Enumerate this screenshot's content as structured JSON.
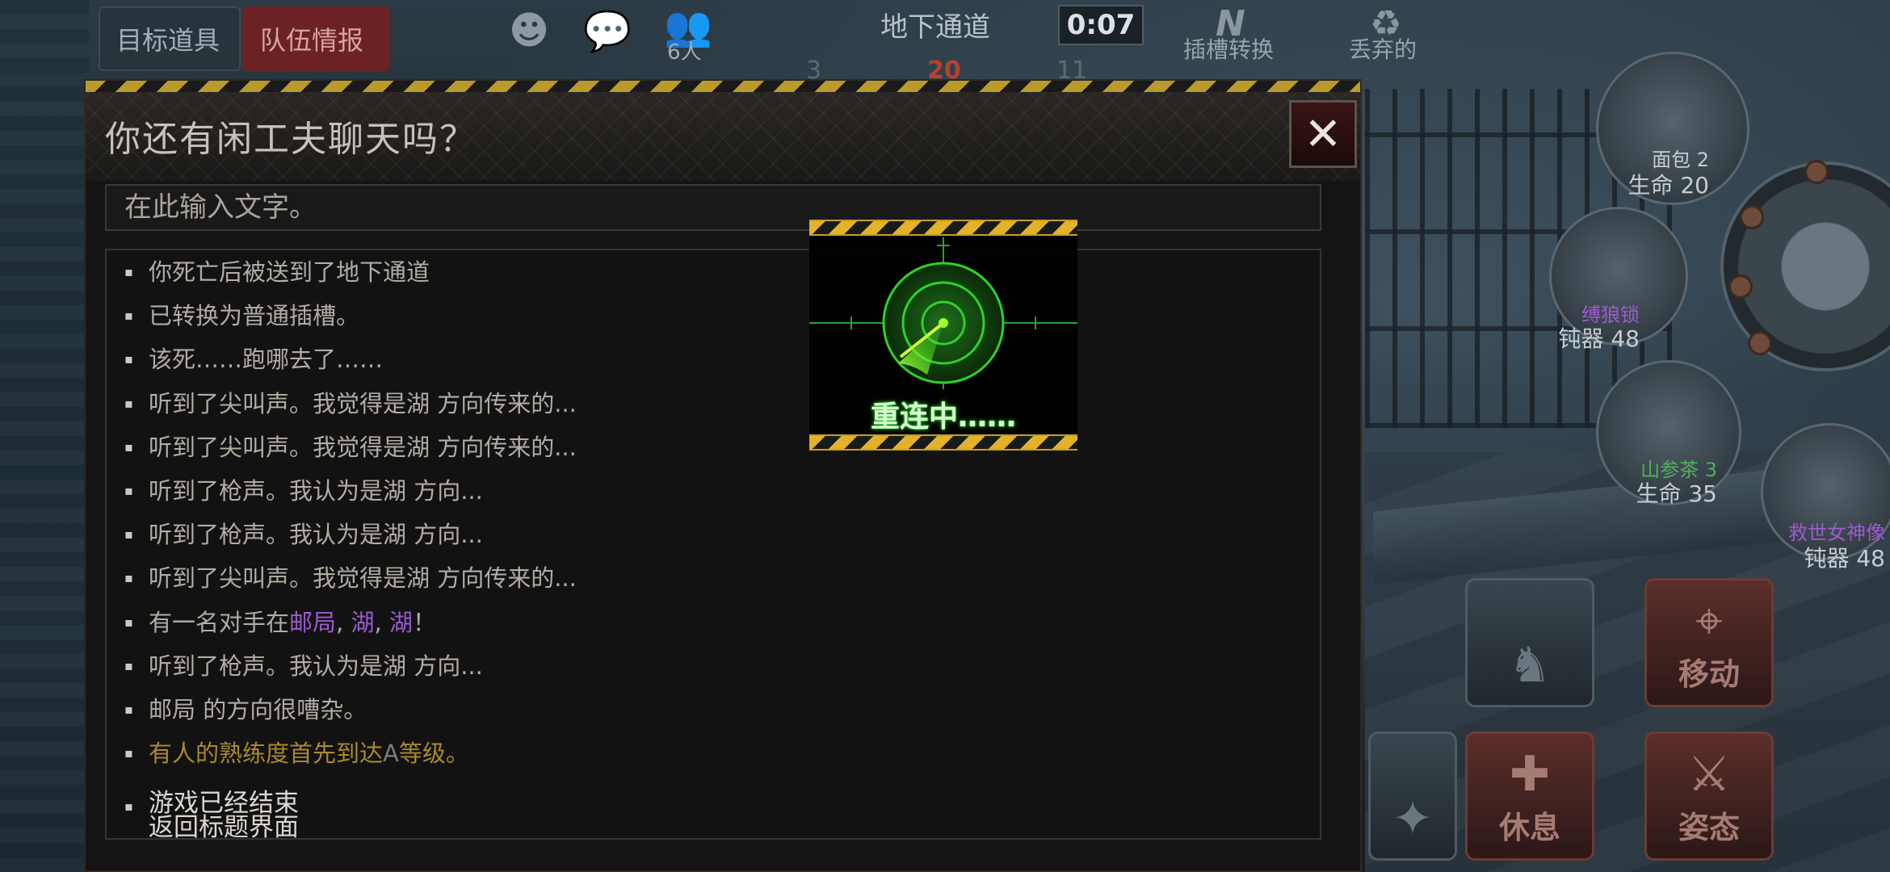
{
  "hud": {
    "target_items_tab": "目标道具",
    "team_info_tab": "队伍情报",
    "player_count": "6人",
    "area_name": "地下通道",
    "timer": "0:07",
    "scores": [
      "3",
      "20",
      "11"
    ],
    "slot_switch_label": "插槽转换",
    "discard_label": "丢弃的"
  },
  "items": [
    {
      "name": "面包 2",
      "stat": "生命 20",
      "name_color": "#c8ccd0"
    },
    {
      "name": "缚狼锁",
      "stat": "钝器 48",
      "name_color": "#9b5bd0"
    },
    {
      "name": "山参茶 3",
      "stat": "生命 35",
      "name_color": "#4fb05b"
    },
    {
      "name": "救世女神像",
      "stat": "钝器 48",
      "name_color": "#9b5bd0"
    }
  ],
  "actions": {
    "move_label": "移动",
    "rest_label": "休息",
    "stance_label": "姿态"
  },
  "chat": {
    "title": "你还有闲工夫聊天吗？",
    "input_placeholder": "在此输入文字。",
    "close_glyph": "✕",
    "messages": [
      "你死亡后被送到了地下通道",
      "已转换为普通插槽。",
      "该死……跑哪去了……",
      "听到了尖叫声。我觉得是湖 方向传来的...",
      "听到了尖叫声。我觉得是湖 方向传来的...",
      "听到了枪声。我认为是湖 方向...",
      "听到了枪声。我认为是湖 方向...",
      "听到了尖叫声。我觉得是湖 方向传来的...",
      "听到了枪声。我认为是湖 方向...",
      "邮局 的方向很嘈杂。"
    ],
    "enemy_msg": {
      "prefix": "有一名对手在",
      "place1": "邮局",
      "sep1": ", ",
      "place2": "湖",
      "sep2": ", ",
      "place3": "湖",
      "suffix": "！"
    },
    "proficiency_msg": {
      "prefix": "有人的熟练度首先到达",
      "grade": "A",
      "suffix": "等级。"
    },
    "game_over_line1": "游戏已经结束",
    "game_over_line2": "返回标题界面"
  },
  "reconnect": {
    "text": "重连中……"
  },
  "colors": {
    "radar_green": "#2dd12a",
    "hazard_yellow": "#e1b329",
    "score_red": "#b8402f"
  }
}
